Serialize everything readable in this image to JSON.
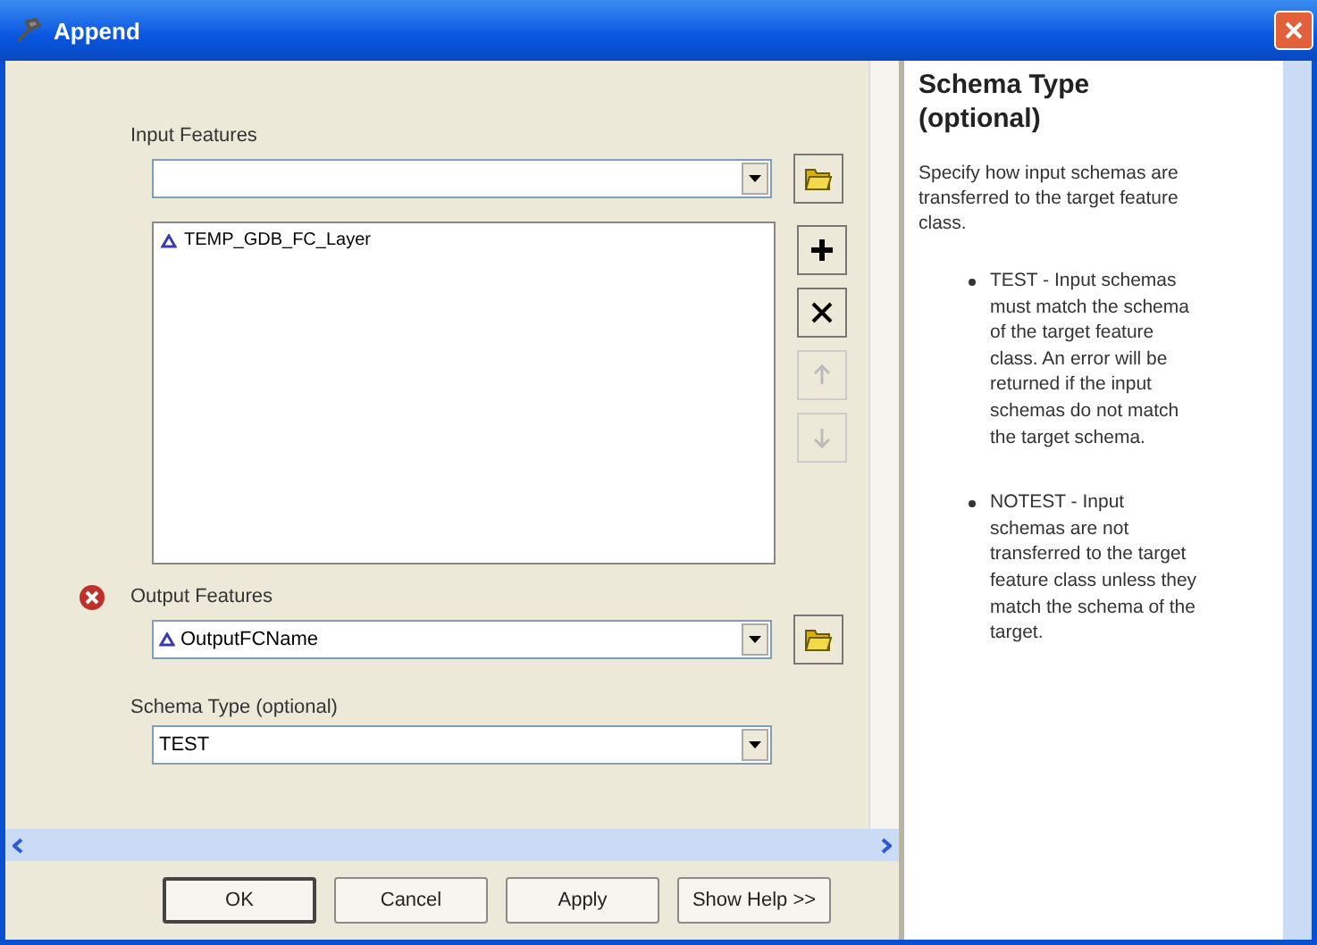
{
  "window": {
    "title": "Append"
  },
  "input_features": {
    "label": "Input Features",
    "items": [
      {
        "name": "TEMP_GDB_FC_Layer"
      }
    ]
  },
  "list_tools": [
    {
      "kind": "add",
      "disabled": false
    },
    {
      "kind": "remove",
      "disabled": false
    },
    {
      "kind": "up",
      "disabled": true
    },
    {
      "kind": "down",
      "disabled": true
    }
  ],
  "output_features": {
    "label": "Output Features",
    "value": "OutputFCName",
    "error": true
  },
  "schema_type": {
    "label": "Schema Type (optional)",
    "value": "TEST"
  },
  "buttons": [
    {
      "label": "OK",
      "default": true
    },
    {
      "label": "Cancel",
      "default": false
    },
    {
      "label": "Apply",
      "default": false
    },
    {
      "label": "Show Help >>",
      "default": false
    }
  ],
  "help": {
    "title": "Schema Type (optional)",
    "intro": "Specify how input schemas are transferred to the target feature class.",
    "bullets": [
      "TEST - Input schemas must match the schema of the target feature class. An error will be returned if the input schemas do not match the target schema.",
      "NOTEST - Input schemas are not transferred to the target feature class unless they match the schema of the target."
    ]
  }
}
